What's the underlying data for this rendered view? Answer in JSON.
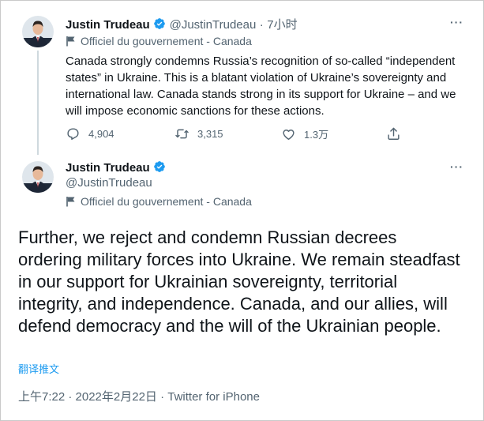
{
  "tweet1": {
    "author_name": "Justin Trudeau",
    "handle": "@JustinTrudeau",
    "separator": "·",
    "time_ago": "7小时",
    "label": "Officiel du gouvernement - Canada",
    "text": "Canada strongly condemns Russia’s recognition of so-called “independent states” in Ukraine. This is a blatant violation of Ukraine’s sovereignty and international law. Canada stands strong in its support for Ukraine – and we will impose economic sanctions for these actions.",
    "replies": "4,904",
    "retweets": "3,315",
    "likes": "1.3万",
    "more": "···"
  },
  "tweet2": {
    "author_name": "Justin Trudeau",
    "handle": "@JustinTrudeau",
    "label": "Officiel du gouvernement - Canada",
    "text": "Further, we reject and condemn Russian decrees ordering military forces into Ukraine. We remain steadfast in our support for Ukrainian sovereignty, territorial integrity, and independence. Canada, and our allies, will defend democracy and the will of the Ukrainian people.",
    "translate": "翻译推文",
    "timestamp": "上午7:22 · 2022年2月22日 · Twitter for iPhone",
    "more": "···"
  },
  "colors": {
    "verified": "#1d9bf0",
    "muted": "#536471",
    "link": "#1d9bf0",
    "thread_line": "#cfd9de"
  },
  "icons": [
    "verified-badge-icon",
    "flag-icon",
    "reply-icon",
    "retweet-icon",
    "like-icon",
    "share-icon",
    "more-icon"
  ]
}
